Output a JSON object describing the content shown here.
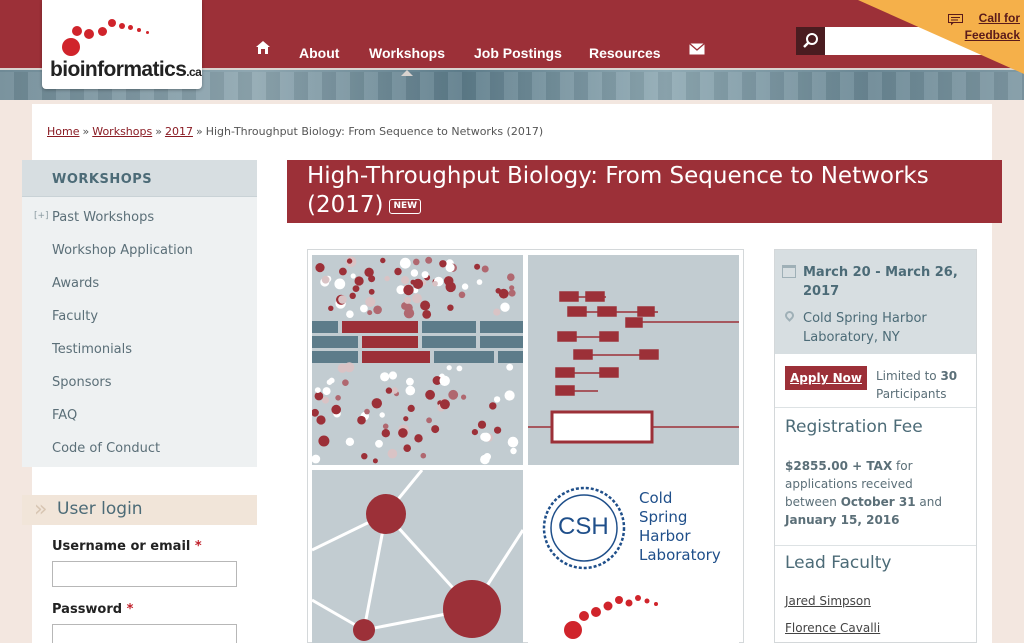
{
  "header": {
    "logo_main": "bioinformatics",
    "logo_tld": ".ca",
    "nav": [
      {
        "label": "About"
      },
      {
        "label": "Workshops"
      },
      {
        "label": "Job Postings"
      },
      {
        "label": "Resources"
      }
    ],
    "search_placeholder": "",
    "feedback_line1": "Call for",
    "feedback_line2": "Feedback"
  },
  "breadcrumb": {
    "home": "Home",
    "workshops": "Workshops",
    "year": "2017",
    "current": "High-Throughput Biology: From Sequence to Networks (2017)",
    "separator": "»"
  },
  "sidebar": {
    "title": "WORKSHOPS",
    "expand_marker": "[+]",
    "items": [
      {
        "label": "Past Workshops"
      },
      {
        "label": "Workshop Application"
      },
      {
        "label": "Awards"
      },
      {
        "label": "Faculty"
      },
      {
        "label": "Testimonials"
      },
      {
        "label": "Sponsors"
      },
      {
        "label": "FAQ"
      },
      {
        "label": "Code of Conduct"
      }
    ]
  },
  "login": {
    "title": "User login",
    "username_label": "Username or email",
    "password_label": "Password",
    "required_marker": "*"
  },
  "main": {
    "title": "High-Throughput Biology: From Sequence to Networks (2017)",
    "badge": "NEW",
    "csh_logo": {
      "abbr": "CSH",
      "line1": "Cold",
      "line2": "Spring",
      "line3": "Harbor",
      "line4": "Laboratory"
    }
  },
  "event": {
    "date": "March 20 - March 26, 2017",
    "location": "Cold Spring Harbor Laboratory, NY",
    "apply_label": "Apply Now",
    "limit_prefix": "Limited to",
    "limit_count": "30",
    "limit_suffix": "Participants",
    "registration_heading": "Registration Fee",
    "fee": "$2855.00 + TAX",
    "fee_text1": "for applications received between",
    "fee_date1": "October 31",
    "fee_and": "and",
    "fee_date2": "January 15, 2016",
    "faculty_heading": "Lead Faculty",
    "faculty": [
      "Jared Simpson",
      "Florence Cavalli"
    ]
  },
  "colors": {
    "brand_red": "#9c3038",
    "slate": "#4c6b77",
    "panel_gray": "#c2ccd1",
    "feedback_orange": "#f5b04a"
  },
  "icons": [
    "home-icon",
    "mail-icon",
    "search-icon",
    "feedback-icon",
    "calendar-icon",
    "location-pin-icon"
  ]
}
